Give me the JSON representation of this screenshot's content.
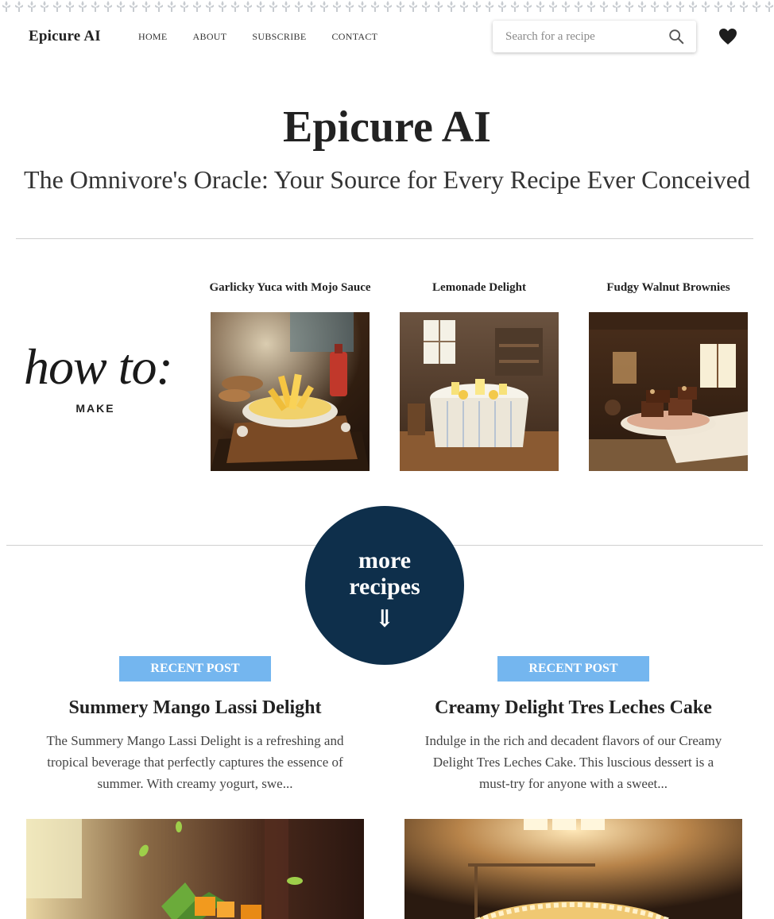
{
  "nav": {
    "brand": "Epicure AI",
    "links": [
      "HOME",
      "ABOUT",
      "SUBSCRIBE",
      "CONTACT"
    ],
    "search_placeholder": "Search for a recipe"
  },
  "hero": {
    "title": "Epicure AI",
    "subtitle": "The Omnivore's Oracle: Your Source for Every Recipe Ever Conceived"
  },
  "howto": {
    "main": "how to:",
    "sub": "MAKE"
  },
  "featured": [
    {
      "title": "Garlicky Yuca with Mojo Sauce"
    },
    {
      "title": "Lemonade Delight"
    },
    {
      "title": "Fudgy Walnut Brownies"
    }
  ],
  "more_button": {
    "line1": "more",
    "line2": "recipes",
    "arrow": "⇓"
  },
  "posts": [
    {
      "badge": "RECENT POST",
      "title": "Summery Mango Lassi Delight",
      "excerpt": "The Summery Mango Lassi Delight is a refreshing and tropical beverage that perfectly captures the essence of summer. With creamy yogurt, swe..."
    },
    {
      "badge": "RECENT POST",
      "title": "Creamy Delight Tres Leches Cake",
      "excerpt": "Indulge in the rich and decadent flavors of our Creamy Delight Tres Leches Cake. This luscious dessert is a must-try for anyone with a sweet..."
    }
  ],
  "colors": {
    "accent_dark": "#0e2f4b",
    "badge_blue": "#74b6ef",
    "text": "#222222"
  }
}
